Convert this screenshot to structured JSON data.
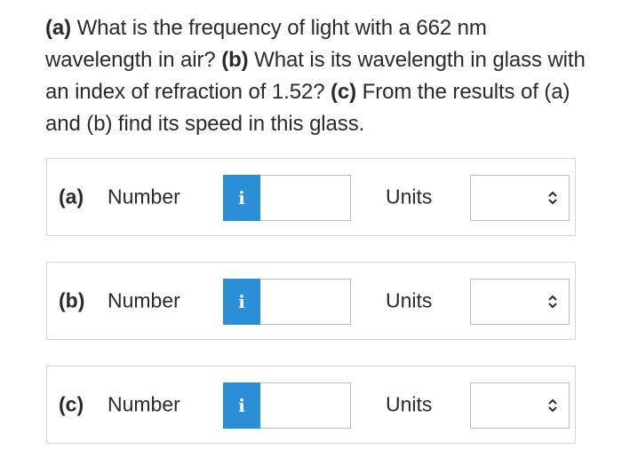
{
  "question": {
    "part_a_label": "(a)",
    "part_a_text": " What is the frequency of light with a 662 nm wavelength in air? ",
    "part_b_label": "(b)",
    "part_b_text": " What is its wavelength in glass with an index of refraction of 1.52? ",
    "part_c_label": "(c)",
    "part_c_text": " From the results of (a) and (b) find its speed in this glass."
  },
  "rows": [
    {
      "letter": "(a)",
      "number_label": "Number",
      "info": "i",
      "number_value": "",
      "units_label": "Units",
      "units_value": ""
    },
    {
      "letter": "(b)",
      "number_label": "Number",
      "info": "i",
      "number_value": "",
      "units_label": "Units",
      "units_value": ""
    },
    {
      "letter": "(c)",
      "number_label": "Number",
      "info": "i",
      "number_value": "",
      "units_label": "Units",
      "units_value": ""
    }
  ],
  "colors": {
    "info_button": "#2b8fd8",
    "text": "#2a2a2a",
    "border": "#d6d6d6"
  },
  "icons": {
    "info": "info-icon",
    "select_arrows": "chevron-up-down-icon"
  }
}
